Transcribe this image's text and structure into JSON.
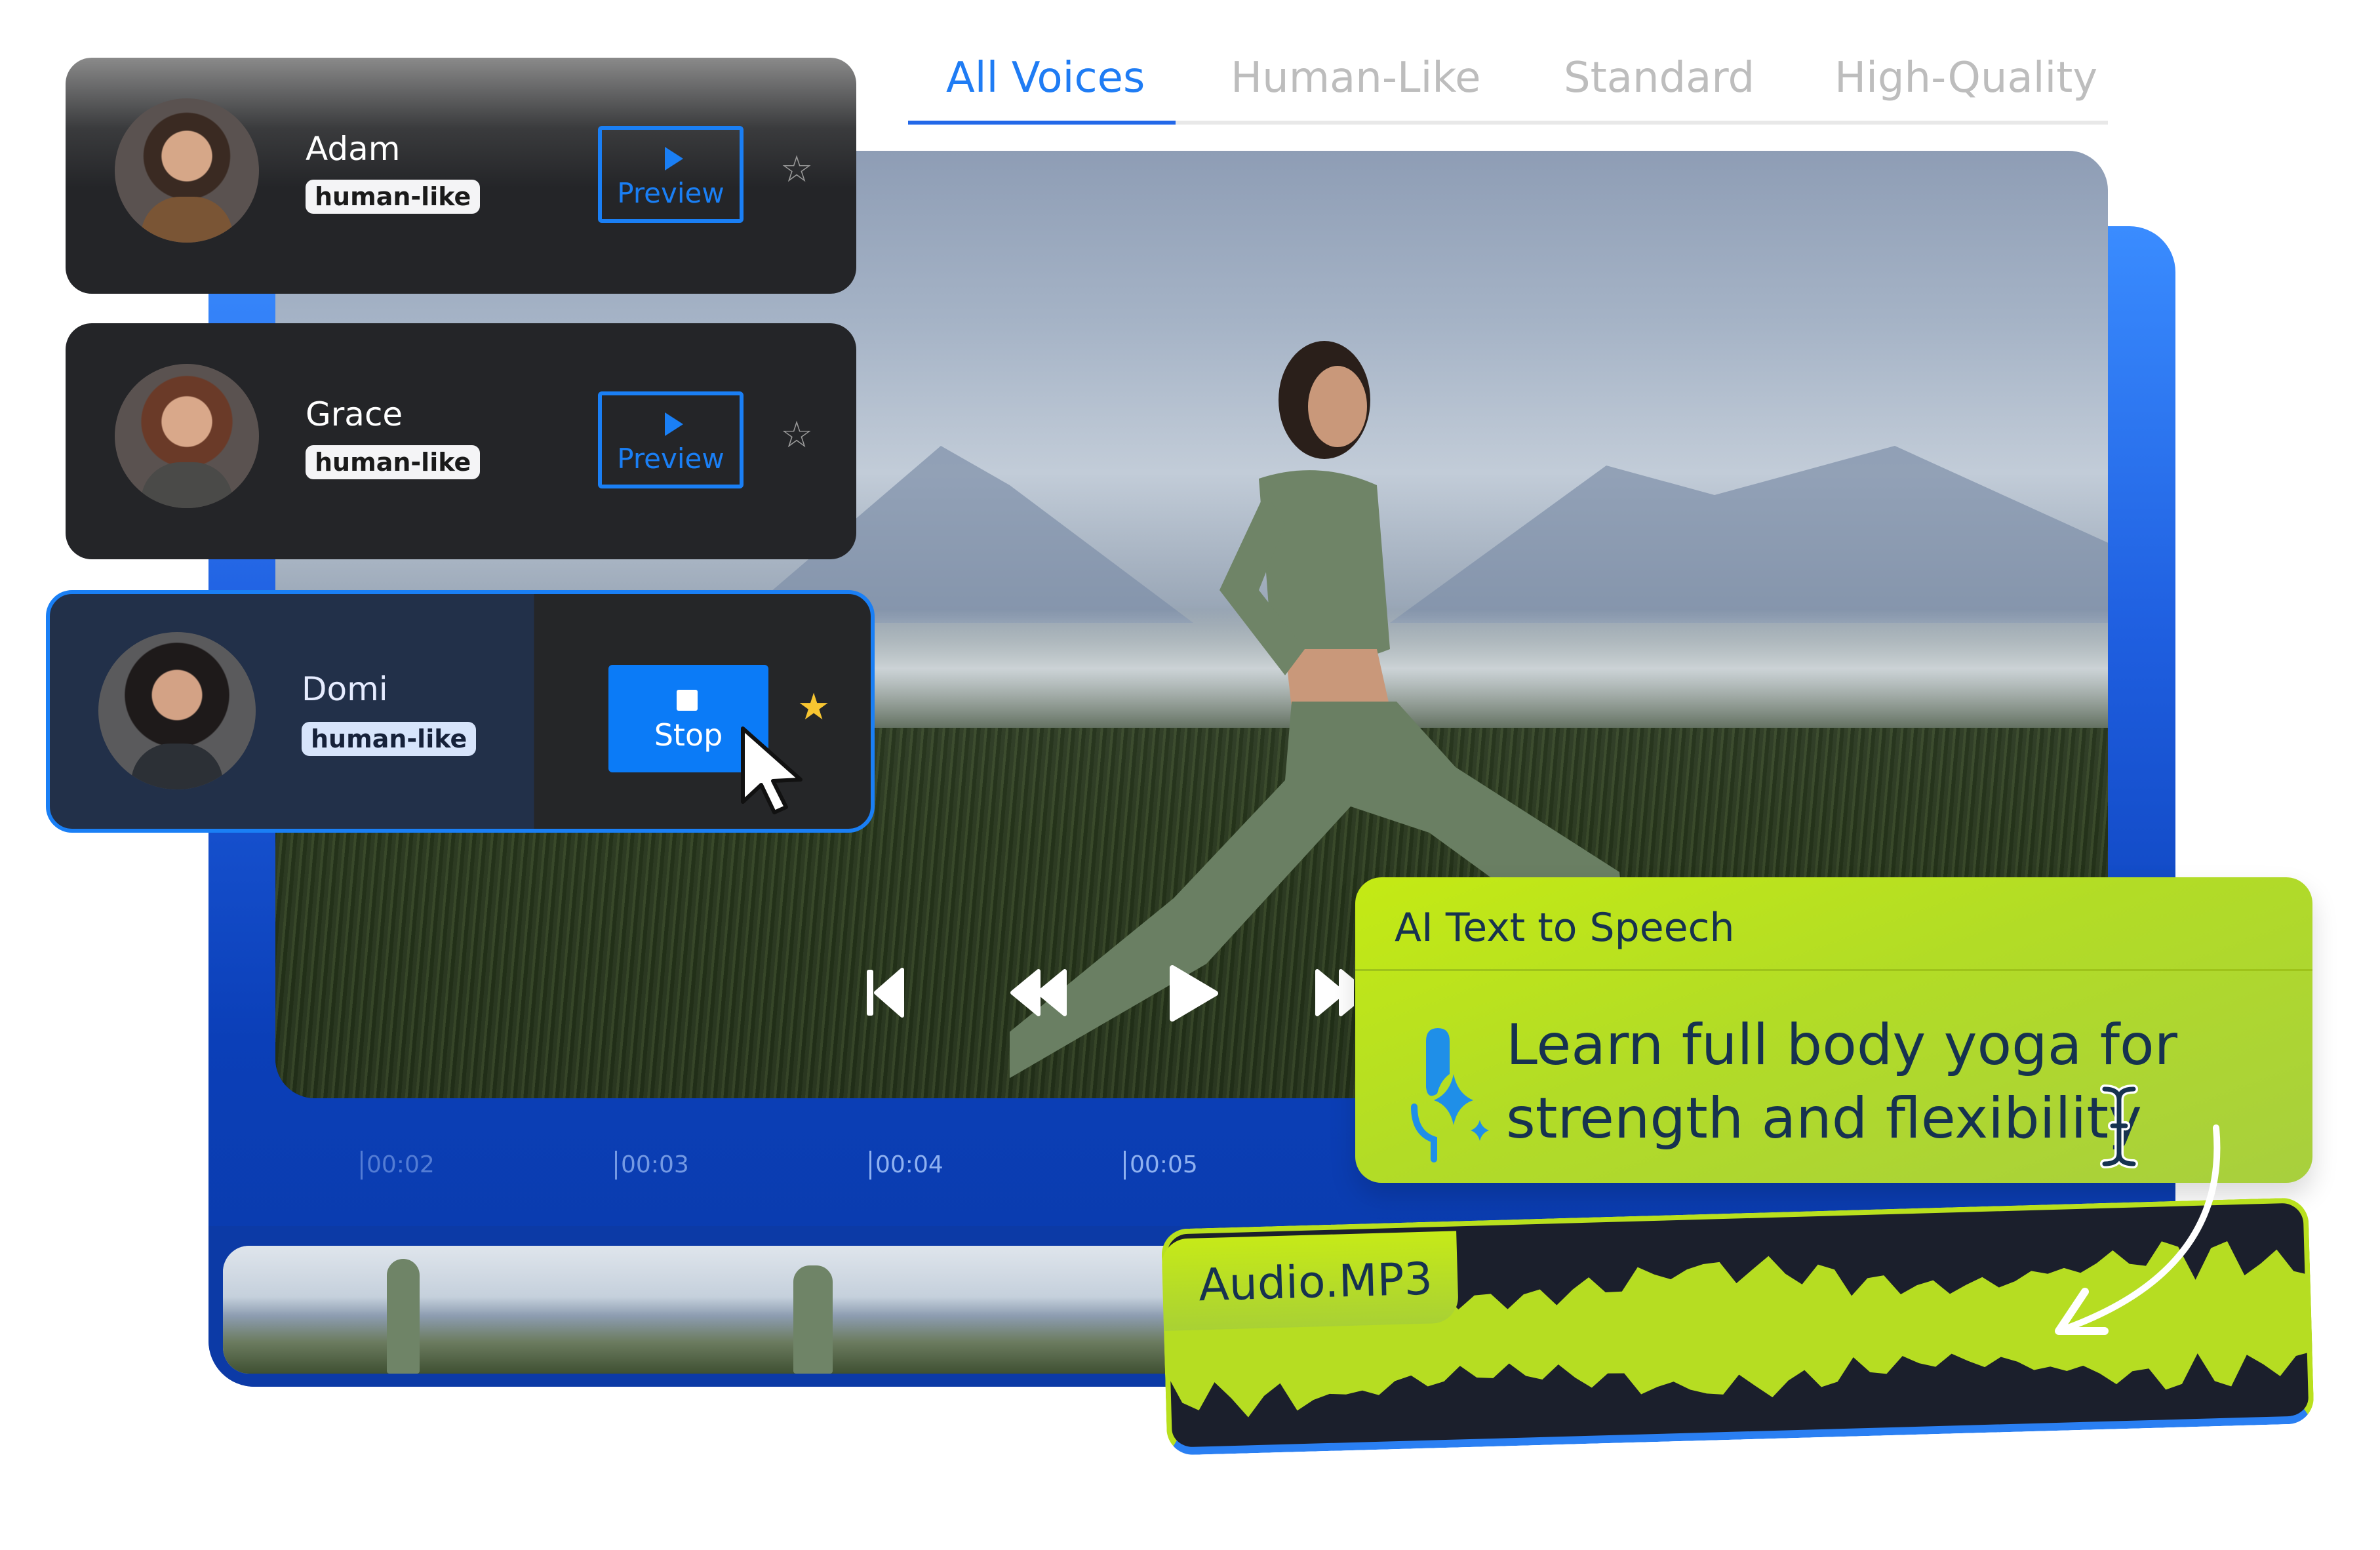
{
  "tabs": {
    "items": [
      {
        "label": "All Voices",
        "active": true
      },
      {
        "label": "Human-Like",
        "active": false
      },
      {
        "label": "Standard",
        "active": false
      },
      {
        "label": "High-Quality",
        "active": false
      }
    ]
  },
  "voices": [
    {
      "name": "Adam",
      "badge": "human-like",
      "button": "Preview",
      "favorite": false,
      "state": "idle"
    },
    {
      "name": "Grace",
      "badge": "human-like",
      "button": "Preview",
      "favorite": false,
      "state": "idle"
    },
    {
      "name": "Domi",
      "badge": "human-like",
      "button": "Stop",
      "favorite": true,
      "state": "playing"
    }
  ],
  "player": {
    "controls": [
      "skip-back",
      "rewind",
      "play",
      "fast-forward"
    ]
  },
  "timeline": {
    "ticks": [
      "00:02",
      "00:03",
      "00:04",
      "00:05"
    ]
  },
  "tts": {
    "title": "AI Text to Speech",
    "text_line1": "Learn full body yoga for",
    "text_line2": "strength and flexibility"
  },
  "audio": {
    "filename": "Audio.MP3"
  },
  "colors": {
    "accent_blue": "#1a7ff5",
    "lime": "#bde41a",
    "navy_text": "#16324f",
    "star_active": "#f7c531"
  }
}
